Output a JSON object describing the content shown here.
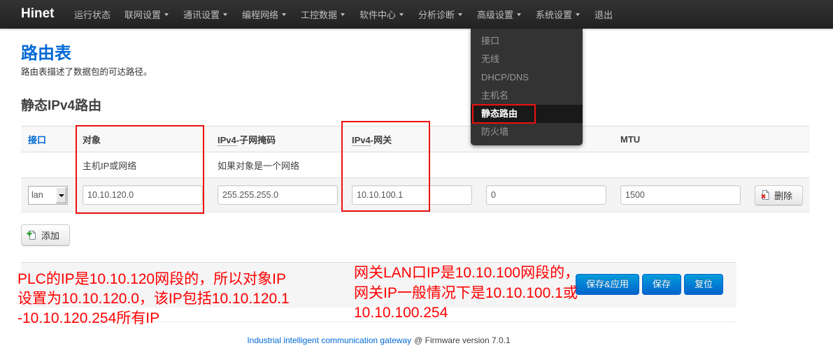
{
  "navbar": {
    "brand": "Hinet",
    "items": [
      {
        "label": "运行状态",
        "has_dropdown": false
      },
      {
        "label": "联网设置",
        "has_dropdown": true
      },
      {
        "label": "通讯设置",
        "has_dropdown": true
      },
      {
        "label": "编程网络",
        "has_dropdown": true
      },
      {
        "label": "工控数据",
        "has_dropdown": true
      },
      {
        "label": "软件中心",
        "has_dropdown": true
      },
      {
        "label": "分析诊断",
        "has_dropdown": true
      },
      {
        "label": "高级设置",
        "has_dropdown": true,
        "open": true
      },
      {
        "label": "系统设置",
        "has_dropdown": true
      },
      {
        "label": "退出",
        "has_dropdown": false
      }
    ]
  },
  "dropdown_menu": {
    "items": [
      {
        "label": "接口"
      },
      {
        "label": "无线"
      },
      {
        "label": "DHCP/DNS"
      },
      {
        "label": "主机名"
      },
      {
        "label": "静态路由",
        "active": true
      },
      {
        "label": "防火墙"
      }
    ]
  },
  "page": {
    "title": "路由表",
    "description": "路由表描述了数据包的可达路径。"
  },
  "section": {
    "title": "静态IPv4路由",
    "columns": {
      "interface": {
        "label": "接口"
      },
      "target": {
        "label": "对象",
        "hint": "主机IP或网络"
      },
      "netmask": {
        "abbr": "IPv4",
        "label": "-子网掩码",
        "hint": "如果对象是一个网络"
      },
      "gateway": {
        "abbr": "IPv4",
        "label": "-网关"
      },
      "mtu": {
        "label": "MTU"
      }
    },
    "rows": [
      {
        "interface": "lan",
        "values": [
          "10.10.120.0",
          "255.255.255.0",
          "10.10.100.1",
          "0",
          "1500"
        ],
        "delete_label": "删除"
      }
    ],
    "add_label": "添加"
  },
  "actions": {
    "save_apply": "保存&应用",
    "save": "保存",
    "reset": "复位"
  },
  "annotations": [
    {
      "lines": [
        "PLC的IP是10.10.120网段的，所以对象IP",
        "设置为10.10.120.0，该IP包括10.10.120.1",
        "-10.10.120.254所有IP"
      ]
    },
    {
      "lines": [
        "网关LAN口IP是10.10.100网段的，",
        "网关IP一般情况下是10.10.100.1或",
        "10.10.100.254"
      ]
    }
  ],
  "footer": {
    "link": "Industrial intelligent communication gateway",
    "text": "@ Firmware version 7.0.1"
  },
  "colors": {
    "brand_blue": "#0069d6",
    "annotation_red": "#ff0000",
    "navbar": "#222222",
    "primary_button": "#0064cd",
    "highlight_box": "#ee1111"
  },
  "icons": {
    "menu_caret": "caret-down-icon",
    "select_arrow": "select-arrow-icon",
    "add": "add-icon",
    "delete": "delete-icon"
  }
}
